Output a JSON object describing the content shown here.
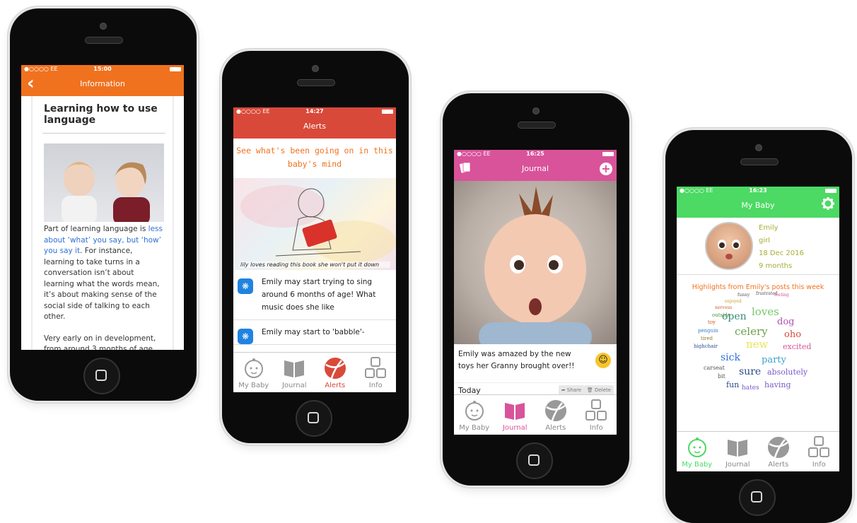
{
  "phone1": {
    "status": {
      "carrier": "●○○○○ EE ",
      "time": "15:00"
    },
    "nav_title": "Information",
    "article": {
      "title": "Learning how to use language",
      "p1_before": "Part of learning language is ",
      "p1_link": "less about ‘what’ you say, but ‘how’ you say it",
      "p1_after": ". For instance, learning to take turns in a conversation isn’t about learning what the words mean, it’s about making sense of the social side of talking to each other.",
      "p2": "Very early on in development, from around 3 months of age,"
    }
  },
  "phone2": {
    "status": {
      "carrier": "●○○○○ EE ",
      "time": "14:27"
    },
    "nav_title": "Alerts",
    "intro": "See what's been going on in this baby's mind",
    "image_caption": "lily loves reading this book she won't put it down",
    "alerts": [
      "Emily may start trying to sing around 6 months of age! What music does she like",
      "Emily may start to 'babble'-"
    ]
  },
  "phone3": {
    "status": {
      "carrier": "●○○○○ EE ",
      "time": "16:25"
    },
    "nav_title": "Journal",
    "post_caption": "Emily was amazed by the new toys her Granny brought over!!",
    "post_date": "Today",
    "share_label": "Share",
    "delete_label": "Delete"
  },
  "phone4": {
    "status": {
      "carrier": "●○○○○ EE ",
      "time": "16:23"
    },
    "nav_title": "My Baby",
    "profile": {
      "name": "Emily",
      "gender": "girl",
      "dob": "18 Dec 2016",
      "age": "9 months"
    },
    "highlights_title": "Highlights from Emily's posts this week",
    "words": [
      "funny",
      "frustrated",
      "feeling",
      "enjoyed",
      "nervous",
      "outside",
      "toy",
      "open",
      "loves",
      "dog",
      "penguin",
      "celery",
      "oho",
      "tired",
      "highchair",
      "new",
      "excited",
      "sick",
      "party",
      "carseat",
      "bit",
      "sure",
      "absolutely",
      "fun",
      "hates",
      "having"
    ]
  },
  "tabs": {
    "mybaby": "My Baby",
    "journal": "Journal",
    "alerts": "Alerts",
    "info": "Info"
  },
  "colors": {
    "information": "#f0721f",
    "alerts": "#d9493a",
    "journal": "#d9539a",
    "mybaby": "#4cd964"
  }
}
